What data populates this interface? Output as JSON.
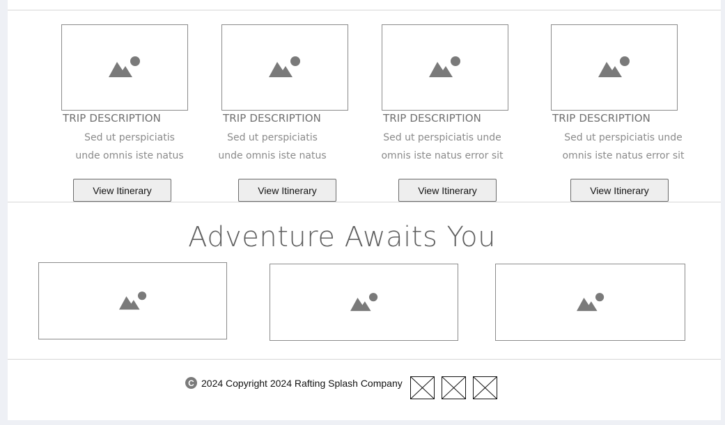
{
  "trips": [
    {
      "title": "TRIP DESCRIPTION",
      "description": "Sed ut perspiciatis unde omnis iste natus error sit voluptatem accusantium",
      "button_label": "View Itinerary",
      "image_icon": "image-placeholder-icon"
    },
    {
      "title": "TRIP DESCRIPTION",
      "description": "Sed ut perspiciatis unde omnis iste natus error sit voluptatem accusantium",
      "button_label": "View Itinerary",
      "image_icon": "image-placeholder-icon"
    },
    {
      "title": "TRIP DESCRIPTION",
      "description": "Sed ut perspiciatis unde omnis iste natus error sit voluptatem accusantium doloremque",
      "button_label": "View Itinerary",
      "image_icon": "image-placeholder-icon"
    },
    {
      "title": "TRIP DESCRIPTION",
      "description": "Sed ut perspiciatis unde omnis iste natus error sit voluptatem accusantium doloremque",
      "button_label": "View Itinerary",
      "image_icon": "image-placeholder-icon"
    }
  ],
  "adventure": {
    "headline": "Adventure Awaits You",
    "images": [
      "image-placeholder-icon",
      "image-placeholder-icon",
      "image-placeholder-icon"
    ]
  },
  "footer": {
    "copyright_icon": "copyright-icon",
    "copyright_text": "2024 Copyright 2024 Rafting Splash Company",
    "social_icons": [
      "broken-image-icon",
      "broken-image-icon",
      "broken-image-icon"
    ]
  },
  "colors": {
    "page_background": "#eef0f5",
    "content_background": "#ffffff",
    "placeholder_icon": "#7a7a7a",
    "button_background": "#eeeeee",
    "text_gray": "#6f6f6f"
  }
}
